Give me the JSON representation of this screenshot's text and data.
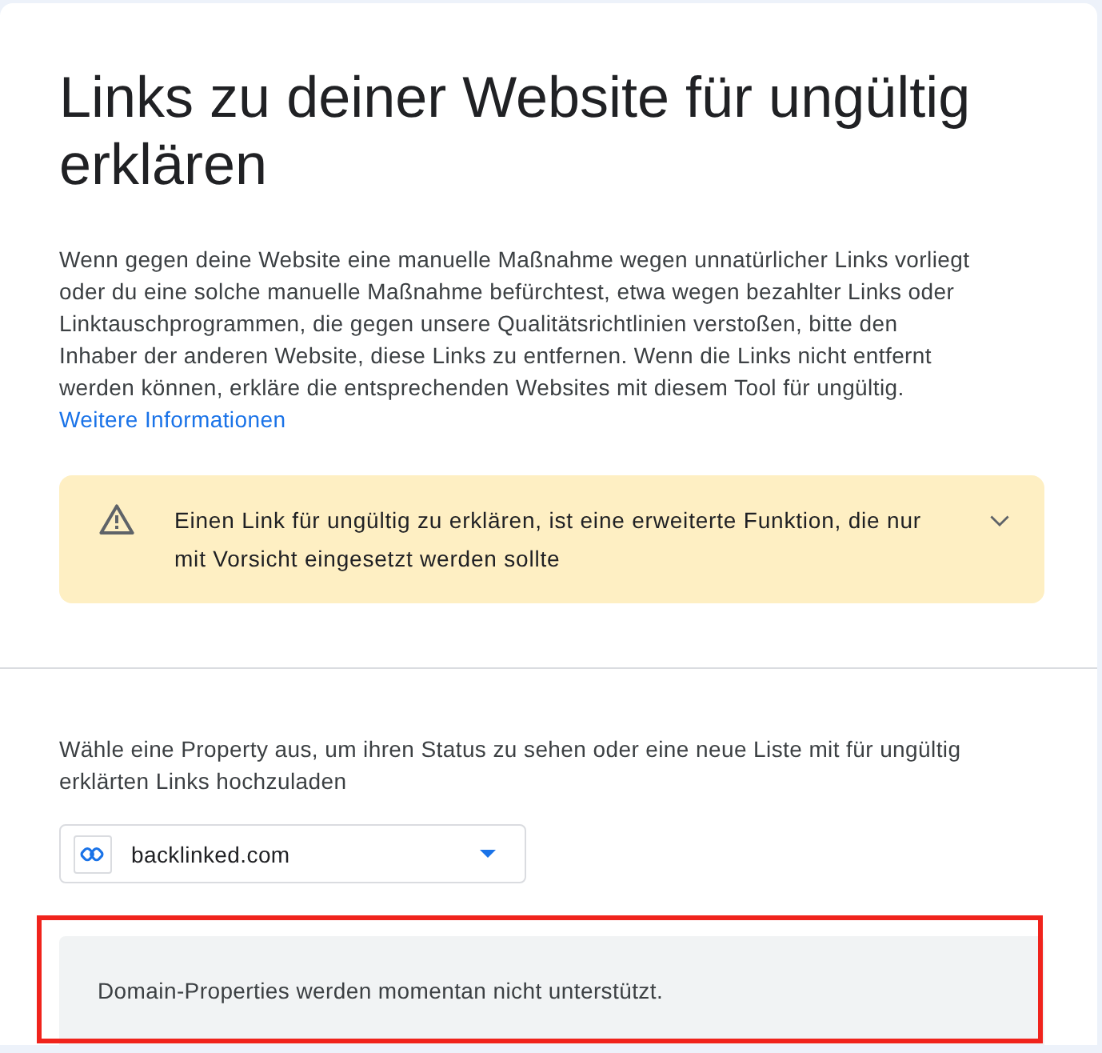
{
  "header": {
    "title": "Links zu deiner Website für ungültig erklären",
    "description": "Wenn gegen deine Website eine manuelle Maßnahme wegen unnatürlicher Links vorliegt oder du eine solche manuelle Maßnahme befürchtest, etwa wegen bezahlter Links oder Linktauschprogrammen, die gegen unsere Qualitätsrichtlinien verstoßen, bitte den Inhaber der anderen Website, diese Links zu entfernen. Wenn die Links nicht entfernt werden können, erkläre die entsprechenden Websites mit diesem Tool für ungültig.",
    "more_link": "Weitere Informationen"
  },
  "warning": {
    "text": "Einen Link für ungültig zu erklären, ist eine erweiterte Funktion, die nur mit Vorsicht eingesetzt werden sollte",
    "expanded": false
  },
  "property_picker": {
    "label": "Wähle eine Property aus, um ihren Status zu sehen oder eine neue Liste mit für ungültig erklärten Links hochzuladen",
    "value": "backlinked.com"
  },
  "notice": {
    "text": "Domain-Properties werden momentan nicht unterstützt.",
    "highlighted": true
  }
}
